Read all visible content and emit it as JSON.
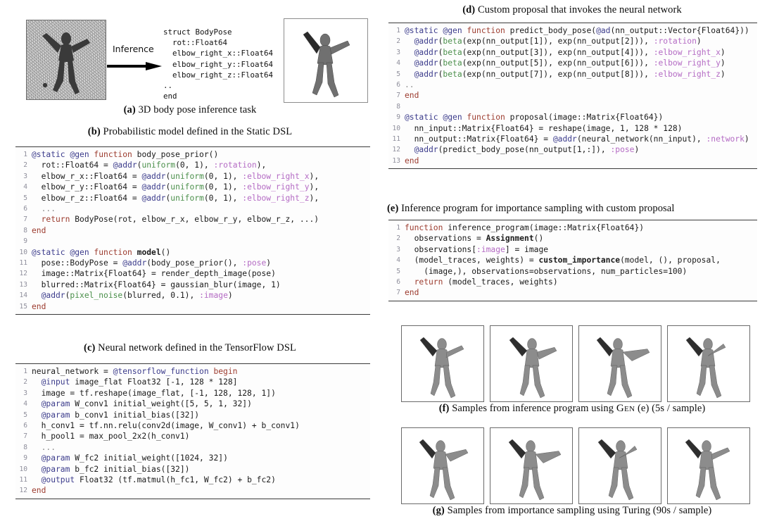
{
  "panel_a": {
    "caption_label": "(a)",
    "caption_text": " 3D body pose inference task",
    "arrow_label": "Inference",
    "struct_code": "struct BodyPose\n  rot::Float64\n  elbow_right_x::Float64\n  elbow_right_y::Float64\n  elbow_right_z::Float64\n..\nend",
    "left_image_name": "noisy-depth-image",
    "right_image_name": "rendered-body-pose"
  },
  "panel_b": {
    "caption_label": "(b)",
    "caption_text": " Probabilistic model defined in the Static DSL",
    "lines": [
      {
        "n": "1",
        "tokens": [
          {
            "c": "t-macro",
            "t": "@static @gen "
          },
          {
            "c": "t-kw",
            "t": "function"
          },
          {
            "c": "t-plain",
            "t": " body_pose_prior()"
          }
        ]
      },
      {
        "n": "2",
        "tokens": [
          {
            "c": "t-plain",
            "t": "  rot::Float64 = "
          },
          {
            "c": "t-macro",
            "t": "@addr"
          },
          {
            "c": "t-plain",
            "t": "("
          },
          {
            "c": "t-fn",
            "t": "uniform"
          },
          {
            "c": "t-plain",
            "t": "(0, 1), "
          },
          {
            "c": "t-sym",
            "t": ":rotation"
          },
          {
            "c": "t-plain",
            "t": "),"
          }
        ]
      },
      {
        "n": "3",
        "tokens": [
          {
            "c": "t-plain",
            "t": "  elbow_r_x::Float64 = "
          },
          {
            "c": "t-macro",
            "t": "@addr"
          },
          {
            "c": "t-plain",
            "t": "("
          },
          {
            "c": "t-fn",
            "t": "uniform"
          },
          {
            "c": "t-plain",
            "t": "(0, 1), "
          },
          {
            "c": "t-sym",
            "t": ":elbow_right_x"
          },
          {
            "c": "t-plain",
            "t": "),"
          }
        ]
      },
      {
        "n": "4",
        "tokens": [
          {
            "c": "t-plain",
            "t": "  elbow_r_y::Float64 = "
          },
          {
            "c": "t-macro",
            "t": "@addr"
          },
          {
            "c": "t-plain",
            "t": "("
          },
          {
            "c": "t-fn",
            "t": "uniform"
          },
          {
            "c": "t-plain",
            "t": "(0, 1), "
          },
          {
            "c": "t-sym",
            "t": ":elbow_right_y"
          },
          {
            "c": "t-plain",
            "t": "),"
          }
        ]
      },
      {
        "n": "5",
        "tokens": [
          {
            "c": "t-plain",
            "t": "  elbow_r_z::Float64 = "
          },
          {
            "c": "t-macro",
            "t": "@addr"
          },
          {
            "c": "t-plain",
            "t": "("
          },
          {
            "c": "t-fn",
            "t": "uniform"
          },
          {
            "c": "t-plain",
            "t": "(0, 1), "
          },
          {
            "c": "t-sym",
            "t": ":elbow_right_z"
          },
          {
            "c": "t-plain",
            "t": "),"
          }
        ]
      },
      {
        "n": "6",
        "tokens": [
          {
            "c": "t-dots",
            "t": "  ..."
          }
        ]
      },
      {
        "n": "7",
        "tokens": [
          {
            "c": "t-kw",
            "t": "  return"
          },
          {
            "c": "t-plain",
            "t": " BodyPose(rot, elbow_r_x, elbow_r_y, elbow_r_z, ...)"
          }
        ]
      },
      {
        "n": "8",
        "tokens": [
          {
            "c": "t-kw",
            "t": "end"
          }
        ]
      },
      {
        "n": "9",
        "tokens": [
          {
            "c": "t-plain",
            "t": ""
          }
        ]
      },
      {
        "n": "10",
        "tokens": [
          {
            "c": "t-macro",
            "t": "@static @gen "
          },
          {
            "c": "t-kw",
            "t": "function"
          },
          {
            "c": "t-bold",
            "t": " model"
          },
          {
            "c": "t-plain",
            "t": "()"
          }
        ]
      },
      {
        "n": "11",
        "tokens": [
          {
            "c": "t-plain",
            "t": "  pose::BodyPose = "
          },
          {
            "c": "t-macro",
            "t": "@addr"
          },
          {
            "c": "t-plain",
            "t": "(body_pose_prior(), "
          },
          {
            "c": "t-sym",
            "t": ":pose"
          },
          {
            "c": "t-plain",
            "t": ")"
          }
        ]
      },
      {
        "n": "12",
        "tokens": [
          {
            "c": "t-plain",
            "t": "  image::Matrix{Float64} = render_depth_image(pose)"
          }
        ]
      },
      {
        "n": "13",
        "tokens": [
          {
            "c": "t-plain",
            "t": "  blurred::Matrix{Float64} = gaussian_blur(image, 1)"
          }
        ]
      },
      {
        "n": "14",
        "tokens": [
          {
            "c": "t-macro",
            "t": "  @addr"
          },
          {
            "c": "t-plain",
            "t": "("
          },
          {
            "c": "t-fn",
            "t": "pixel_noise"
          },
          {
            "c": "t-plain",
            "t": "(blurred, 0.1), "
          },
          {
            "c": "t-sym",
            "t": ":image"
          },
          {
            "c": "t-plain",
            "t": ")"
          }
        ]
      },
      {
        "n": "15",
        "tokens": [
          {
            "c": "t-kw",
            "t": "end"
          }
        ]
      }
    ]
  },
  "panel_c": {
    "caption_label": "(c)",
    "caption_text": " Neural network defined in the TensorFlow DSL",
    "lines": [
      {
        "n": "1",
        "tokens": [
          {
            "c": "t-plain",
            "t": "neural_network = "
          },
          {
            "c": "t-macro",
            "t": "@tensorflow_function"
          },
          {
            "c": "t-kw",
            "t": " begin"
          }
        ]
      },
      {
        "n": "2",
        "tokens": [
          {
            "c": "t-macro",
            "t": "  @input"
          },
          {
            "c": "t-plain",
            "t": " image_flat Float32 [-1, 128 * 128]"
          }
        ]
      },
      {
        "n": "3",
        "tokens": [
          {
            "c": "t-plain",
            "t": "  image = tf.reshape(image_flat, [-1, 128, 128, 1])"
          }
        ]
      },
      {
        "n": "4",
        "tokens": [
          {
            "c": "t-macro",
            "t": "  @param"
          },
          {
            "c": "t-plain",
            "t": " W_conv1 initial_weight([5, 5, 1, 32])"
          }
        ]
      },
      {
        "n": "5",
        "tokens": [
          {
            "c": "t-macro",
            "t": "  @param"
          },
          {
            "c": "t-plain",
            "t": " b_conv1 initial_bias([32])"
          }
        ]
      },
      {
        "n": "6",
        "tokens": [
          {
            "c": "t-plain",
            "t": "  h_conv1 = tf.nn.relu(conv2d(image, W_conv1) + b_conv1)"
          }
        ]
      },
      {
        "n": "7",
        "tokens": [
          {
            "c": "t-plain",
            "t": "  h_pool1 = max_pool_2x2(h_conv1)"
          }
        ]
      },
      {
        "n": "8",
        "tokens": [
          {
            "c": "t-dots",
            "t": "  ..."
          }
        ]
      },
      {
        "n": "9",
        "tokens": [
          {
            "c": "t-macro",
            "t": "  @param"
          },
          {
            "c": "t-plain",
            "t": " W_fc2 initial_weight([1024, 32])"
          }
        ]
      },
      {
        "n": "10",
        "tokens": [
          {
            "c": "t-macro",
            "t": "  @param"
          },
          {
            "c": "t-plain",
            "t": " b_fc2 initial_bias([32])"
          }
        ]
      },
      {
        "n": "11",
        "tokens": [
          {
            "c": "t-macro",
            "t": "  @output"
          },
          {
            "c": "t-plain",
            "t": " Float32 (tf.matmul(h_fc1, W_fc2) + b_fc2)"
          }
        ]
      },
      {
        "n": "12",
        "tokens": [
          {
            "c": "t-kw",
            "t": "end"
          }
        ]
      }
    ]
  },
  "panel_d": {
    "caption_label": "(d)",
    "caption_text": " Custom proposal that invokes the neural network",
    "lines": [
      {
        "n": "1",
        "tokens": [
          {
            "c": "t-macro",
            "t": "@static @gen "
          },
          {
            "c": "t-kw",
            "t": "function"
          },
          {
            "c": "t-plain",
            "t": " predict_body_pose("
          },
          {
            "c": "t-macro",
            "t": "@ad"
          },
          {
            "c": "t-plain",
            "t": "(nn_output::Vector{Float64}))"
          }
        ]
      },
      {
        "n": "2",
        "tokens": [
          {
            "c": "t-macro",
            "t": "  @addr"
          },
          {
            "c": "t-plain",
            "t": "("
          },
          {
            "c": "t-fn",
            "t": "beta"
          },
          {
            "c": "t-plain",
            "t": "(exp(nn_output[1]), exp(nn_output[2])), "
          },
          {
            "c": "t-sym",
            "t": ":rotation"
          },
          {
            "c": "t-plain",
            "t": ")"
          }
        ]
      },
      {
        "n": "3",
        "tokens": [
          {
            "c": "t-macro",
            "t": "  @addr"
          },
          {
            "c": "t-plain",
            "t": "("
          },
          {
            "c": "t-fn",
            "t": "beta"
          },
          {
            "c": "t-plain",
            "t": "(exp(nn_output[3]), exp(nn_output[4])), "
          },
          {
            "c": "t-sym",
            "t": ":elbow_right_x"
          },
          {
            "c": "t-plain",
            "t": ")"
          }
        ]
      },
      {
        "n": "4",
        "tokens": [
          {
            "c": "t-macro",
            "t": "  @addr"
          },
          {
            "c": "t-plain",
            "t": "("
          },
          {
            "c": "t-fn",
            "t": "beta"
          },
          {
            "c": "t-plain",
            "t": "(exp(nn_output[5]), exp(nn_output[6])), "
          },
          {
            "c": "t-sym",
            "t": ":elbow_right_y"
          },
          {
            "c": "t-plain",
            "t": ")"
          }
        ]
      },
      {
        "n": "5",
        "tokens": [
          {
            "c": "t-macro",
            "t": "  @addr"
          },
          {
            "c": "t-plain",
            "t": "("
          },
          {
            "c": "t-fn",
            "t": "beta"
          },
          {
            "c": "t-plain",
            "t": "(exp(nn_output[7]), exp(nn_output[8])), "
          },
          {
            "c": "t-sym",
            "t": ":elbow_right_z"
          },
          {
            "c": "t-plain",
            "t": ")"
          }
        ]
      },
      {
        "n": "6",
        "tokens": [
          {
            "c": "t-dots",
            "t": ".."
          }
        ]
      },
      {
        "n": "7",
        "tokens": [
          {
            "c": "t-kw",
            "t": "end"
          }
        ]
      },
      {
        "n": "8",
        "tokens": [
          {
            "c": "t-plain",
            "t": ""
          }
        ]
      },
      {
        "n": "9",
        "tokens": [
          {
            "c": "t-macro",
            "t": "@static @gen "
          },
          {
            "c": "t-kw",
            "t": "function"
          },
          {
            "c": "t-plain",
            "t": " proposal(image::Matrix{Float64})"
          }
        ]
      },
      {
        "n": "10",
        "tokens": [
          {
            "c": "t-plain",
            "t": "  nn_input::Matrix{Float64} = reshape(image, 1, 128 * 128)"
          }
        ]
      },
      {
        "n": "11",
        "tokens": [
          {
            "c": "t-plain",
            "t": "  nn_output::Matrix{Float64} = "
          },
          {
            "c": "t-macro",
            "t": "@addr"
          },
          {
            "c": "t-plain",
            "t": "(neural_network(nn_input), "
          },
          {
            "c": "t-sym",
            "t": ":network"
          },
          {
            "c": "t-plain",
            "t": ")"
          }
        ]
      },
      {
        "n": "12",
        "tokens": [
          {
            "c": "t-macro",
            "t": "  @addr"
          },
          {
            "c": "t-plain",
            "t": "(predict_body_pose(nn_output[1,:]), "
          },
          {
            "c": "t-sym",
            "t": ":pose"
          },
          {
            "c": "t-plain",
            "t": ")"
          }
        ]
      },
      {
        "n": "13",
        "tokens": [
          {
            "c": "t-kw",
            "t": "end"
          }
        ]
      }
    ]
  },
  "panel_e": {
    "caption_label": "(e)",
    "caption_text": " Inference program for importance sampling with custom proposal",
    "lines": [
      {
        "n": "1",
        "tokens": [
          {
            "c": "t-kw",
            "t": "function"
          },
          {
            "c": "t-plain",
            "t": " inference_program(image::Matrix{Float64})"
          }
        ]
      },
      {
        "n": "2",
        "tokens": [
          {
            "c": "t-plain",
            "t": "  observations = "
          },
          {
            "c": "t-bold",
            "t": "Assignment"
          },
          {
            "c": "t-plain",
            "t": "()"
          }
        ]
      },
      {
        "n": "3",
        "tokens": [
          {
            "c": "t-plain",
            "t": "  observations["
          },
          {
            "c": "t-sym",
            "t": ":image"
          },
          {
            "c": "t-plain",
            "t": "] = image"
          }
        ]
      },
      {
        "n": "4",
        "tokens": [
          {
            "c": "t-plain",
            "t": "  (model_traces, weights) = "
          },
          {
            "c": "t-bold",
            "t": "custom_importance"
          },
          {
            "c": "t-plain",
            "t": "(model, (), proposal,"
          }
        ]
      },
      {
        "n": "5",
        "tokens": [
          {
            "c": "t-plain",
            "t": "    (image,), observations=observations, num_particles=100)"
          }
        ]
      },
      {
        "n": "6",
        "tokens": [
          {
            "c": "t-kw",
            "t": "  return"
          },
          {
            "c": "t-plain",
            "t": " (model_traces, weights)"
          }
        ]
      },
      {
        "n": "7",
        "tokens": [
          {
            "c": "t-kw",
            "t": "end"
          }
        ]
      }
    ]
  },
  "panel_f": {
    "caption_label": "(f)",
    "caption_pre": " Samples from inference program using ",
    "caption_smallcaps": "Gen",
    "caption_post": " (e) (5s / sample)",
    "sample_count": 4,
    "sample_name": "inference-sample"
  },
  "panel_g": {
    "caption_label": "(g)",
    "caption_text": " Samples from importance sampling using Turing (90s / sample)",
    "sample_count": 4,
    "sample_name": "importance-sample"
  },
  "colors": {
    "macro": "#3c3c8c",
    "keyword": "#9c3b2e",
    "function": "#4a8f4a",
    "symbol": "#b46bc4",
    "line_number": "#8f8f9c",
    "rule": "#3a3a3a"
  }
}
